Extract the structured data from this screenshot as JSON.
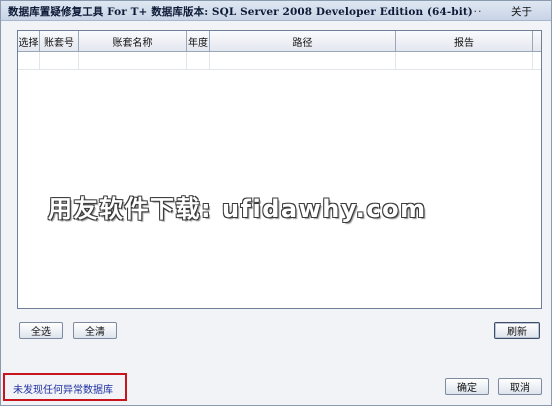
{
  "window": {
    "title": "数据库置疑修复工具 For T+ 数据库版本: SQL Server 2008  Developer Edition (64-bit)",
    "dots": "...",
    "about_label": "关于"
  },
  "grid": {
    "columns": [
      "选择",
      "账套号",
      "账套名称",
      "年度",
      "路径",
      "报告"
    ]
  },
  "watermark": "用友软件下载: ufidawhy.com",
  "buttons": {
    "select_all": "全选",
    "clear": "全清",
    "refresh": "刷新",
    "ok": "确定",
    "cancel": "取消"
  },
  "status": {
    "message": "未发现任何异常数据库"
  },
  "colors": {
    "status_text": "#1e2fa0",
    "status_border": "#c8141c"
  }
}
